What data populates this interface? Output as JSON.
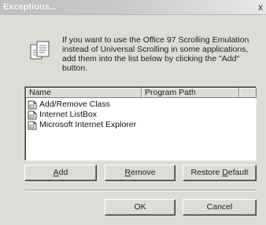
{
  "window": {
    "title": "Exceptions...",
    "close_glyph": "x"
  },
  "info": {
    "icon": "document-list-icon",
    "text": "If you want to use the Office 97 Scrolling Emulation instead of Universal Scrolling in some applications, add them into the list below by clicking the \"Add\" button."
  },
  "listview": {
    "columns": [
      "Name",
      "Program Path",
      ""
    ],
    "items": [
      {
        "name": "Add/Remove Class",
        "path": "",
        "icon": "application-file-icon"
      },
      {
        "name": "Internet ListBox",
        "path": "",
        "icon": "application-file-icon"
      },
      {
        "name": "Microsoft Internet Explorer",
        "path": "",
        "icon": "application-file-icon"
      }
    ]
  },
  "buttons": {
    "add": {
      "accel": "A",
      "rest": "dd"
    },
    "remove": {
      "accel": "R",
      "rest": "emove"
    },
    "restore": {
      "pre": "Restore ",
      "accel": "D",
      "rest": "efault"
    },
    "ok": "OK",
    "cancel": "Cancel"
  }
}
